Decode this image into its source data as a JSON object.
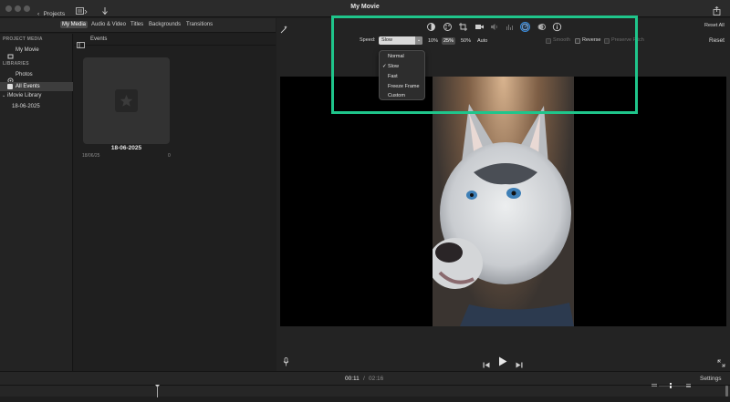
{
  "app": {
    "title": "My Movie",
    "back_label": "Projects"
  },
  "browser_tabs": [
    {
      "label": "My Media",
      "active": true
    },
    {
      "label": "Audio & Video",
      "active": false
    },
    {
      "label": "Titles",
      "active": false
    },
    {
      "label": "Backgrounds",
      "active": false
    },
    {
      "label": "Transitions",
      "active": false
    }
  ],
  "sidebar": {
    "project_media_header": "PROJECT MEDIA",
    "project_item": "My Movie",
    "libraries_header": "LIBRARIES",
    "photos": "Photos",
    "all_events": "All Events",
    "library": "iMovie Library",
    "event": "18-06-2025"
  },
  "events_panel": {
    "header": "Events",
    "event_title": "18-06-2025",
    "event_date": "18/06/25",
    "event_count": "0"
  },
  "viewer": {
    "reset_all": "Reset All",
    "reset": "Reset",
    "speed_label": "Speed:",
    "speed_value": "Slow",
    "speed_options": [
      "10%",
      "25%",
      "50%",
      "Auto"
    ],
    "selected_speed_option": "25%",
    "smooth_label": "Smooth",
    "reverse_label": "Reverse",
    "preserve_pitch_label": "Preserve Pitch",
    "menu_items": [
      "Normal",
      "Slow",
      "Fast",
      "Freeze Frame",
      "Custom"
    ],
    "menu_checked": "Slow",
    "checkmark": "✓"
  },
  "timeline": {
    "current_time": "00:11",
    "separator": "/",
    "total_time": "02:16",
    "settings_label": "Settings"
  },
  "colors": {
    "highlight": "#1fc58b",
    "active_tool": "#3b8fe0"
  }
}
